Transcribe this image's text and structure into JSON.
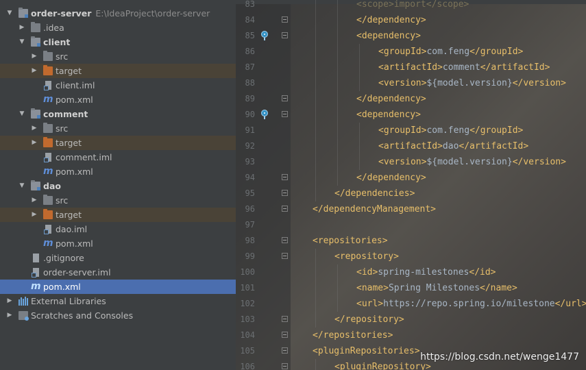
{
  "project": {
    "rows": [
      {
        "label": "order-server",
        "hint": "E:\\IdeaProject\\order-server",
        "depth": 0,
        "expanded": true,
        "icon": "module-folder-icon",
        "bold": true
      },
      {
        "label": ".idea",
        "depth": 1,
        "expanded": false,
        "icon": "folder-icon"
      },
      {
        "label": "client",
        "depth": 1,
        "expanded": true,
        "icon": "module-folder-icon",
        "bold": true
      },
      {
        "label": "src",
        "depth": 2,
        "expanded": false,
        "icon": "folder-icon"
      },
      {
        "label": "target",
        "depth": 2,
        "expanded": false,
        "icon": "excluded-folder-icon",
        "excluded": true
      },
      {
        "label": "client.iml",
        "depth": 2,
        "icon": "iml-file-icon"
      },
      {
        "label": "pom.xml",
        "depth": 2,
        "icon": "maven-icon"
      },
      {
        "label": "comment",
        "depth": 1,
        "expanded": true,
        "icon": "module-folder-icon",
        "bold": true
      },
      {
        "label": "src",
        "depth": 2,
        "expanded": false,
        "icon": "folder-icon"
      },
      {
        "label": "target",
        "depth": 2,
        "expanded": false,
        "icon": "excluded-folder-icon",
        "excluded": true
      },
      {
        "label": "comment.iml",
        "depth": 2,
        "icon": "iml-file-icon"
      },
      {
        "label": "pom.xml",
        "depth": 2,
        "icon": "maven-icon"
      },
      {
        "label": "dao",
        "depth": 1,
        "expanded": true,
        "icon": "module-folder-icon",
        "bold": true
      },
      {
        "label": "src",
        "depth": 2,
        "expanded": false,
        "icon": "folder-icon"
      },
      {
        "label": "target",
        "depth": 2,
        "expanded": false,
        "icon": "excluded-folder-icon",
        "excluded": true
      },
      {
        "label": "dao.iml",
        "depth": 2,
        "icon": "iml-file-icon"
      },
      {
        "label": "pom.xml",
        "depth": 2,
        "icon": "maven-icon"
      },
      {
        "label": ".gitignore",
        "depth": 1,
        "icon": "gitignore-file-icon"
      },
      {
        "label": "order-server.iml",
        "depth": 1,
        "icon": "iml-file-icon"
      },
      {
        "label": "pom.xml",
        "depth": 1,
        "icon": "maven-icon",
        "selected": true
      },
      {
        "label": "External Libraries",
        "depth": 0,
        "expanded": false,
        "icon": "libraries-icon"
      },
      {
        "label": "Scratches and Consoles",
        "depth": 0,
        "expanded": false,
        "icon": "scratches-icon"
      }
    ]
  },
  "editor": {
    "lines": [
      {
        "num": "83",
        "indent": 2,
        "parts": [
          [
            "tag",
            "<scope>"
          ],
          [
            "txt",
            "import"
          ],
          [
            "tag",
            "</scope>"
          ]
        ],
        "partial": true
      },
      {
        "num": "84",
        "indent": 2,
        "parts": [
          [
            "tag",
            "</dependency>"
          ]
        ],
        "fold": "close"
      },
      {
        "num": "85",
        "indent": 2,
        "parts": [
          [
            "tag",
            "<dependency>"
          ]
        ],
        "fold": "open",
        "marker": true
      },
      {
        "num": "86",
        "indent": 3,
        "parts": [
          [
            "tag",
            "<groupId>"
          ],
          [
            "txt",
            "com.feng"
          ],
          [
            "tag",
            "</groupId>"
          ]
        ]
      },
      {
        "num": "87",
        "indent": 3,
        "parts": [
          [
            "tag",
            "<artifactId>"
          ],
          [
            "txt",
            "comment"
          ],
          [
            "tag",
            "</artifactId>"
          ]
        ]
      },
      {
        "num": "88",
        "indent": 3,
        "parts": [
          [
            "tag",
            "<version>"
          ],
          [
            "txt",
            "${model.version}"
          ],
          [
            "tag",
            "</version>"
          ]
        ]
      },
      {
        "num": "89",
        "indent": 2,
        "parts": [
          [
            "tag",
            "</dependency>"
          ]
        ],
        "fold": "close"
      },
      {
        "num": "90",
        "indent": 2,
        "parts": [
          [
            "tag",
            "<dependency>"
          ]
        ],
        "fold": "open",
        "marker": true
      },
      {
        "num": "91",
        "indent": 3,
        "parts": [
          [
            "tag",
            "<groupId>"
          ],
          [
            "txt",
            "com.feng"
          ],
          [
            "tag",
            "</groupId>"
          ]
        ]
      },
      {
        "num": "92",
        "indent": 3,
        "parts": [
          [
            "tag",
            "<artifactId>"
          ],
          [
            "txt",
            "dao"
          ],
          [
            "tag",
            "</artifactId>"
          ]
        ]
      },
      {
        "num": "93",
        "indent": 3,
        "parts": [
          [
            "tag",
            "<version>"
          ],
          [
            "txt",
            "${model.version}"
          ],
          [
            "tag",
            "</version>"
          ]
        ]
      },
      {
        "num": "94",
        "indent": 2,
        "parts": [
          [
            "tag",
            "</dependency>"
          ]
        ],
        "fold": "close"
      },
      {
        "num": "95",
        "indent": 1,
        "parts": [
          [
            "tag",
            "</dependencies>"
          ]
        ],
        "fold": "close"
      },
      {
        "num": "96",
        "indent": 0,
        "parts": [
          [
            "tag",
            "</dependencyManagement>"
          ]
        ],
        "fold": "close"
      },
      {
        "num": "97",
        "indent": 0,
        "parts": []
      },
      {
        "num": "98",
        "indent": 0,
        "parts": [
          [
            "tag",
            "<repositories>"
          ]
        ],
        "fold": "open"
      },
      {
        "num": "99",
        "indent": 1,
        "parts": [
          [
            "tag",
            "<repository>"
          ]
        ],
        "fold": "open"
      },
      {
        "num": "100",
        "indent": 2,
        "parts": [
          [
            "tag",
            "<id>"
          ],
          [
            "txt",
            "spring-milestones"
          ],
          [
            "tag",
            "</id>"
          ]
        ]
      },
      {
        "num": "101",
        "indent": 2,
        "parts": [
          [
            "tag",
            "<name>"
          ],
          [
            "txt",
            "Spring Milestones"
          ],
          [
            "tag",
            "</name>"
          ]
        ]
      },
      {
        "num": "102",
        "indent": 2,
        "parts": [
          [
            "tag",
            "<url>"
          ],
          [
            "txt",
            "https://repo.spring.io/milestone"
          ],
          [
            "tag",
            "</url>"
          ]
        ]
      },
      {
        "num": "103",
        "indent": 1,
        "parts": [
          [
            "tag",
            "</repository>"
          ]
        ],
        "fold": "close"
      },
      {
        "num": "104",
        "indent": 0,
        "parts": [
          [
            "tag",
            "</repositories>"
          ]
        ],
        "fold": "close"
      },
      {
        "num": "105",
        "indent": 0,
        "parts": [
          [
            "tag",
            "<pluginRepositories>"
          ]
        ],
        "fold": "open"
      },
      {
        "num": "106",
        "indent": 1,
        "parts": [
          [
            "tag",
            "<pluginRepository>"
          ]
        ],
        "fold": "open"
      }
    ]
  },
  "watermark": "https://blog.csdn.net/wenge1477",
  "colors": {
    "tag": "#e8bf6a",
    "text": "#a9b7c6",
    "selection": "#4b6eaf",
    "excluded": "#4a4337"
  }
}
